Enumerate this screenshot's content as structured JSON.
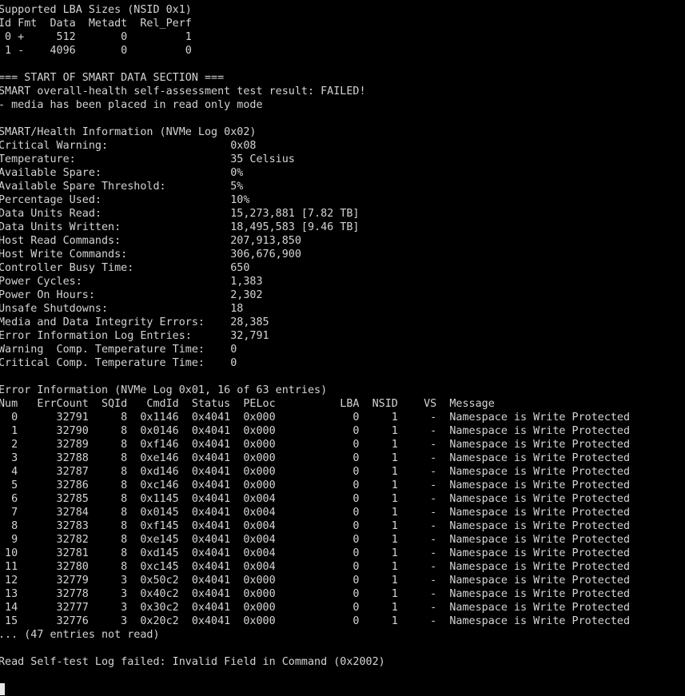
{
  "terminal": {
    "lines": [
      "Supported LBA Sizes (NSID 0x1)",
      "Id Fmt  Data  Metadt  Rel_Perf",
      " 0 +     512       0         1",
      " 1 -    4096       0         0",
      "",
      "=== START OF SMART DATA SECTION ===",
      "SMART overall-health self-assessment test result: FAILED!",
      "- media has been placed in read only mode",
      "",
      "SMART/Health Information (NVMe Log 0x02)",
      "Critical Warning:                   0x08",
      "Temperature:                        35 Celsius",
      "Available Spare:                    0%",
      "Available Spare Threshold:          5%",
      "Percentage Used:                    10%",
      "Data Units Read:                    15,273,881 [7.82 TB]",
      "Data Units Written:                 18,495,583 [9.46 TB]",
      "Host Read Commands:                 207,913,850",
      "Host Write Commands:                306,676,900",
      "Controller Busy Time:               650",
      "Power Cycles:                       1,383",
      "Power On Hours:                     2,302",
      "Unsafe Shutdowns:                   18",
      "Media and Data Integrity Errors:    28,385",
      "Error Information Log Entries:      32,791",
      "Warning  Comp. Temperature Time:    0",
      "Critical Comp. Temperature Time:    0",
      "",
      "Error Information (NVMe Log 0x01, 16 of 63 entries)",
      "Num   ErrCount  SQId   CmdId  Status  PELoc          LBA  NSID    VS  Message",
      "  0      32791     8  0x1146  0x4041  0x000            0     1     -  Namespace is Write Protected",
      "  1      32790     8  0x0146  0x4041  0x000            0     1     -  Namespace is Write Protected",
      "  2      32789     8  0xf146  0x4041  0x000            0     1     -  Namespace is Write Protected",
      "  3      32788     8  0xe146  0x4041  0x000            0     1     -  Namespace is Write Protected",
      "  4      32787     8  0xd146  0x4041  0x000            0     1     -  Namespace is Write Protected",
      "  5      32786     8  0xc146  0x4041  0x000            0     1     -  Namespace is Write Protected",
      "  6      32785     8  0x1145  0x4041  0x004            0     1     -  Namespace is Write Protected",
      "  7      32784     8  0x0145  0x4041  0x004            0     1     -  Namespace is Write Protected",
      "  8      32783     8  0xf145  0x4041  0x004            0     1     -  Namespace is Write Protected",
      "  9      32782     8  0xe145  0x4041  0x004            0     1     -  Namespace is Write Protected",
      " 10      32781     8  0xd145  0x4041  0x004            0     1     -  Namespace is Write Protected",
      " 11      32780     8  0xc145  0x4041  0x004            0     1     -  Namespace is Write Protected",
      " 12      32779     3  0x50c2  0x4041  0x000            0     1     -  Namespace is Write Protected",
      " 13      32778     3  0x40c2  0x4041  0x000            0     1     -  Namespace is Write Protected",
      " 14      32777     3  0x30c2  0x4041  0x000            0     1     -  Namespace is Write Protected",
      " 15      32776     3  0x20c2  0x4041  0x000            0     1     -  Namespace is Write Protected",
      "... (47 entries not read)",
      "",
      "Read Self-test Log failed: Invalid Field in Command (0x2002)",
      ""
    ],
    "prompt": "",
    "colors": {
      "background": "#000000",
      "foreground": "#d4d4d4",
      "cursor": "#e6e6e6"
    }
  }
}
